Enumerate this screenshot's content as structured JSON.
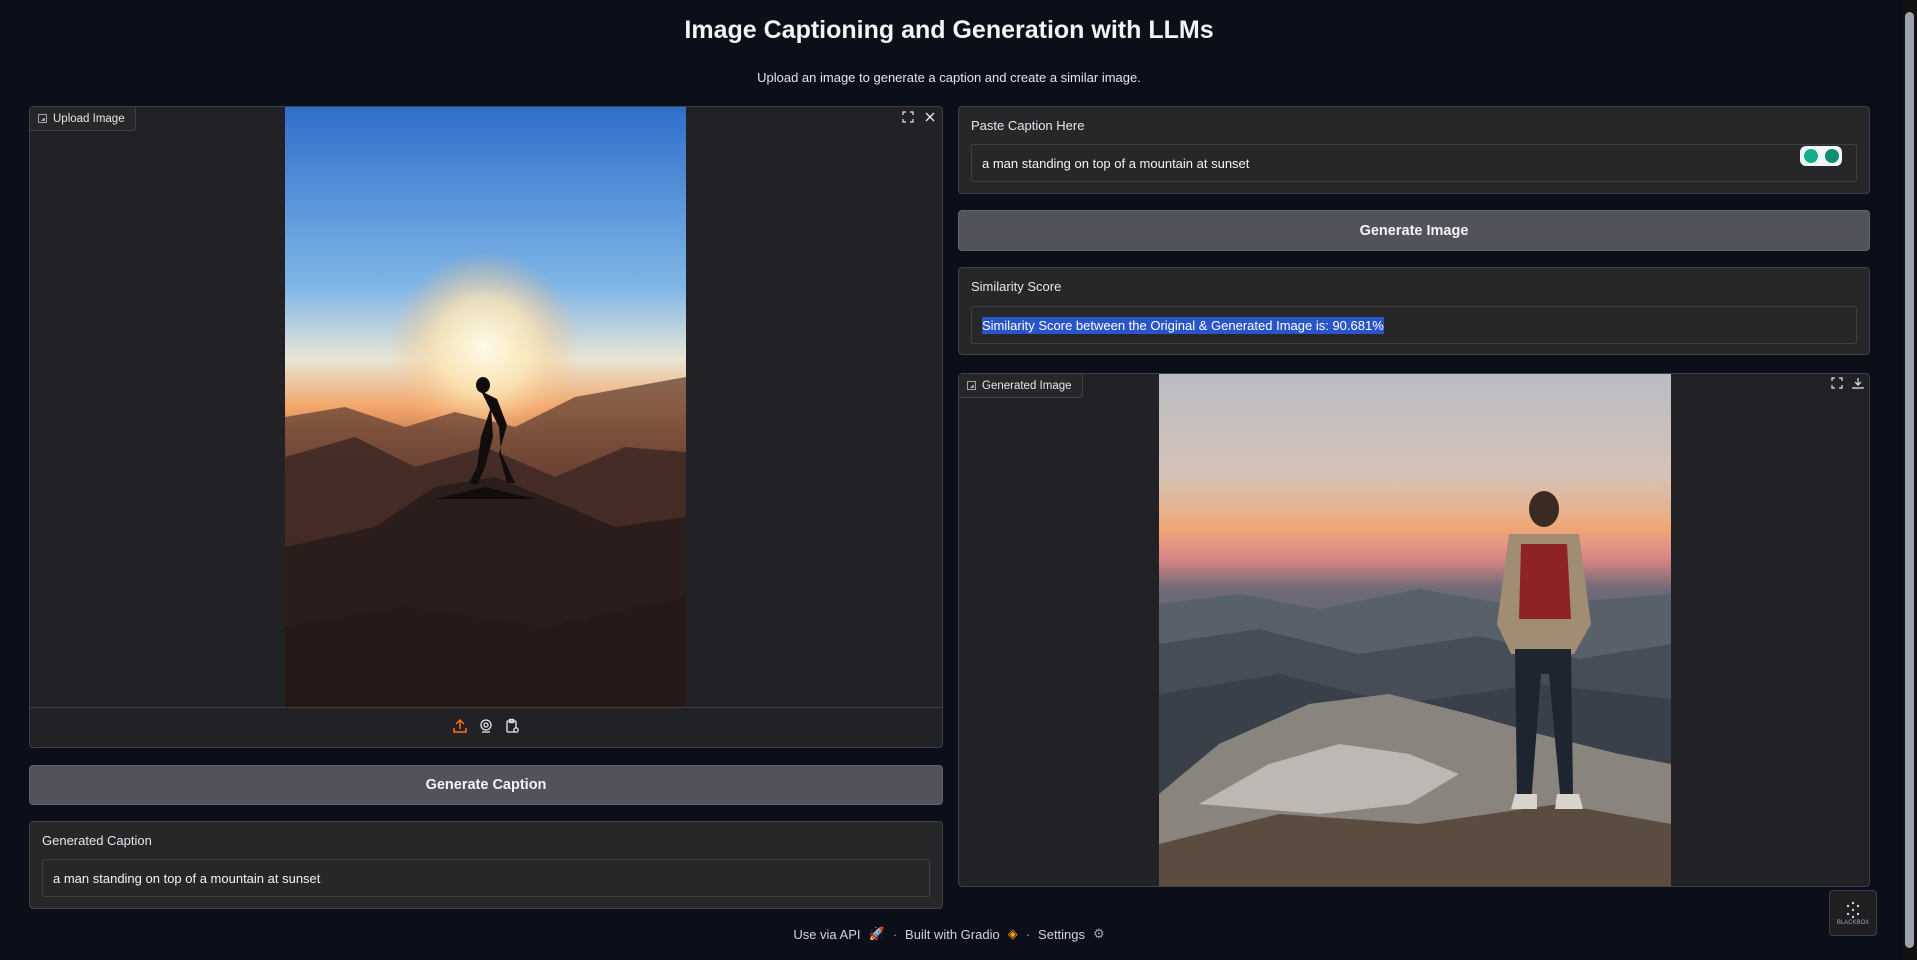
{
  "header": {
    "title": "Image Captioning and Generation with LLMs",
    "subtitle": "Upload an image to generate a caption and create a similar image."
  },
  "left": {
    "upload_label": "Upload Image",
    "toolbar_icons": [
      "upload-icon",
      "webcam-icon",
      "clipboard-icon"
    ],
    "generate_caption_button": "Generate Caption",
    "generated_caption_label": "Generated Caption",
    "generated_caption_value": "a man standing on top of a mountain at sunset"
  },
  "right": {
    "paste_caption_label": "Paste Caption Here",
    "paste_caption_value": "a man standing on top of a mountain at sunset",
    "generate_image_button": "Generate Image",
    "similarity_label": "Similarity Score",
    "similarity_value": "Similarity Score between the Original & Generated Image is: 90.681%",
    "generated_image_label": "Generated Image"
  },
  "footer": {
    "api": "Use via API",
    "built": "Built with Gradio",
    "settings": "Settings"
  },
  "badge": {
    "text": "BLACKBOX"
  },
  "colors": {
    "background": "#0b0f19",
    "panel": "#27272a",
    "button": "#52525b",
    "accent": "#f97316",
    "selection": "#2a55c8"
  }
}
